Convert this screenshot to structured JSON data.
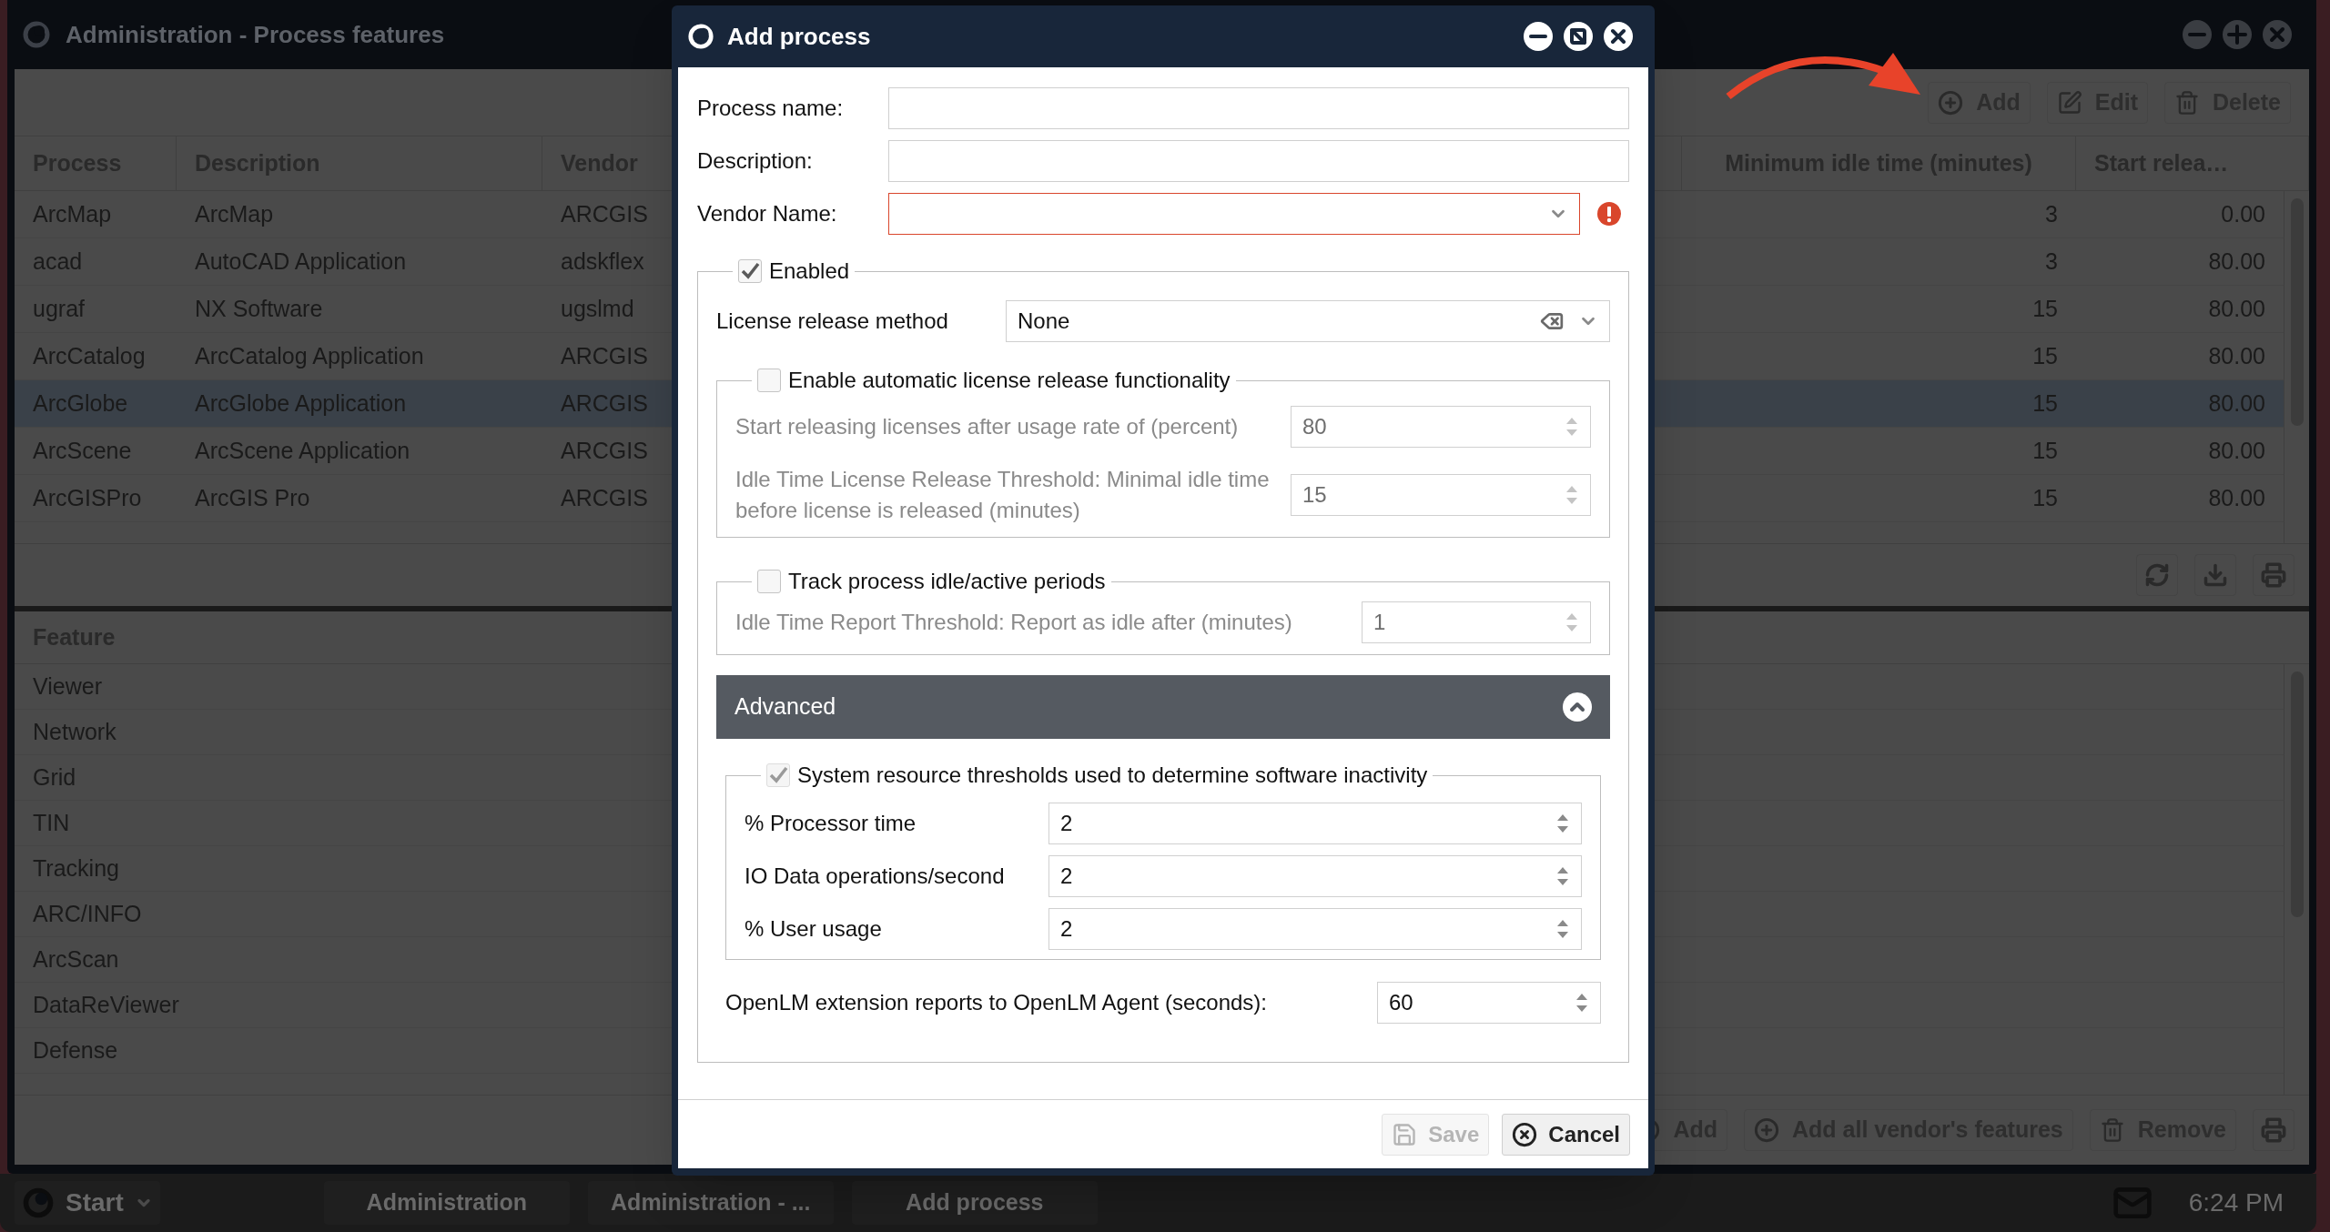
{
  "background_window": {
    "title": "Administration - Process features",
    "toolbar": [
      {
        "kind": "add",
        "label": "Add"
      },
      {
        "kind": "edit",
        "label": "Edit"
      },
      {
        "kind": "delete",
        "label": "Delete"
      }
    ],
    "process_table": {
      "columns": [
        "Process",
        "Description",
        "Vendor",
        "Minimum idle time (minutes)",
        "Start relea…"
      ],
      "rows": [
        {
          "cells": [
            "ArcMap",
            "ArcMap",
            "ARCGIS",
            "3",
            "0.00"
          ],
          "selected": false
        },
        {
          "cells": [
            "acad",
            "AutoCAD Application",
            "adskflex",
            "3",
            "80.00"
          ],
          "selected": false
        },
        {
          "cells": [
            "ugraf",
            "NX Software",
            "ugslmd",
            "15",
            "80.00"
          ],
          "selected": false
        },
        {
          "cells": [
            "ArcCatalog",
            "ArcCatalog Application",
            "ARCGIS",
            "15",
            "80.00"
          ],
          "selected": false
        },
        {
          "cells": [
            "ArcGlobe",
            "ArcGlobe Application",
            "ARCGIS",
            "15",
            "80.00"
          ],
          "selected": true
        },
        {
          "cells": [
            "ArcScene",
            "ArcScene Application",
            "ARCGIS",
            "15",
            "80.00"
          ],
          "selected": false
        },
        {
          "cells": [
            "ArcGISPro",
            "ArcGIS Pro",
            "ARCGIS",
            "15",
            "80.00"
          ],
          "selected": false
        }
      ]
    },
    "feature_list": {
      "header": "Feature",
      "rows": [
        "Viewer",
        "Network",
        "Grid",
        "TIN",
        "Tracking",
        "ARC/INFO",
        "ArcScan",
        "DataReViewer",
        "Defense"
      ]
    },
    "feature_toolbar": [
      {
        "kind": "add",
        "label": "Add"
      },
      {
        "kind": "add",
        "label": "Add all vendor's features"
      },
      {
        "kind": "remove",
        "label": "Remove"
      }
    ]
  },
  "dialog": {
    "title": "Add process",
    "fields": [
      {
        "label": "Process name:",
        "kind": "text",
        "error": false
      },
      {
        "label": "Description:",
        "kind": "text",
        "error": false
      },
      {
        "label": "Vendor Name:",
        "kind": "combo",
        "error": true
      }
    ],
    "enabled_group": {
      "label": "Enabled",
      "checked": true,
      "license_release_method": {
        "label": "License release method",
        "value": "None"
      },
      "auto_release": {
        "label": "Enable automatic license release functionality",
        "checked": false,
        "rows": [
          {
            "label": "Start releasing licenses after usage rate of (percent)",
            "value": "80"
          },
          {
            "label": "Idle Time License Release Threshold: Minimal idle time before license is released (minutes)",
            "value": "15"
          }
        ]
      },
      "tracking": {
        "label": "Track process idle/active periods",
        "checked": false,
        "rows": [
          {
            "label": "Idle Time Report Threshold: Report as idle after (minutes)",
            "value": "1"
          }
        ]
      },
      "advanced": {
        "label": "Advanced",
        "expanded": true,
        "thresholds": {
          "label": "System resource thresholds used to determine software inactivity",
          "checked": true,
          "disabled": true,
          "rows": [
            {
              "label": "% Processor time",
              "value": "2"
            },
            {
              "label": "IO Data operations/second",
              "value": "2"
            },
            {
              "label": "% User usage",
              "value": "2"
            }
          ]
        },
        "report_interval": {
          "label": "OpenLM extension reports to OpenLM Agent (seconds):",
          "value": "60"
        }
      }
    },
    "buttons": [
      {
        "kind": "save",
        "label": "Save",
        "disabled": true
      },
      {
        "kind": "cancel",
        "label": "Cancel",
        "disabled": false
      }
    ]
  },
  "taskbar": {
    "start": "Start",
    "items": [
      "Administration",
      "Administration - ...",
      "Add process"
    ],
    "clock": "6:24 PM"
  }
}
